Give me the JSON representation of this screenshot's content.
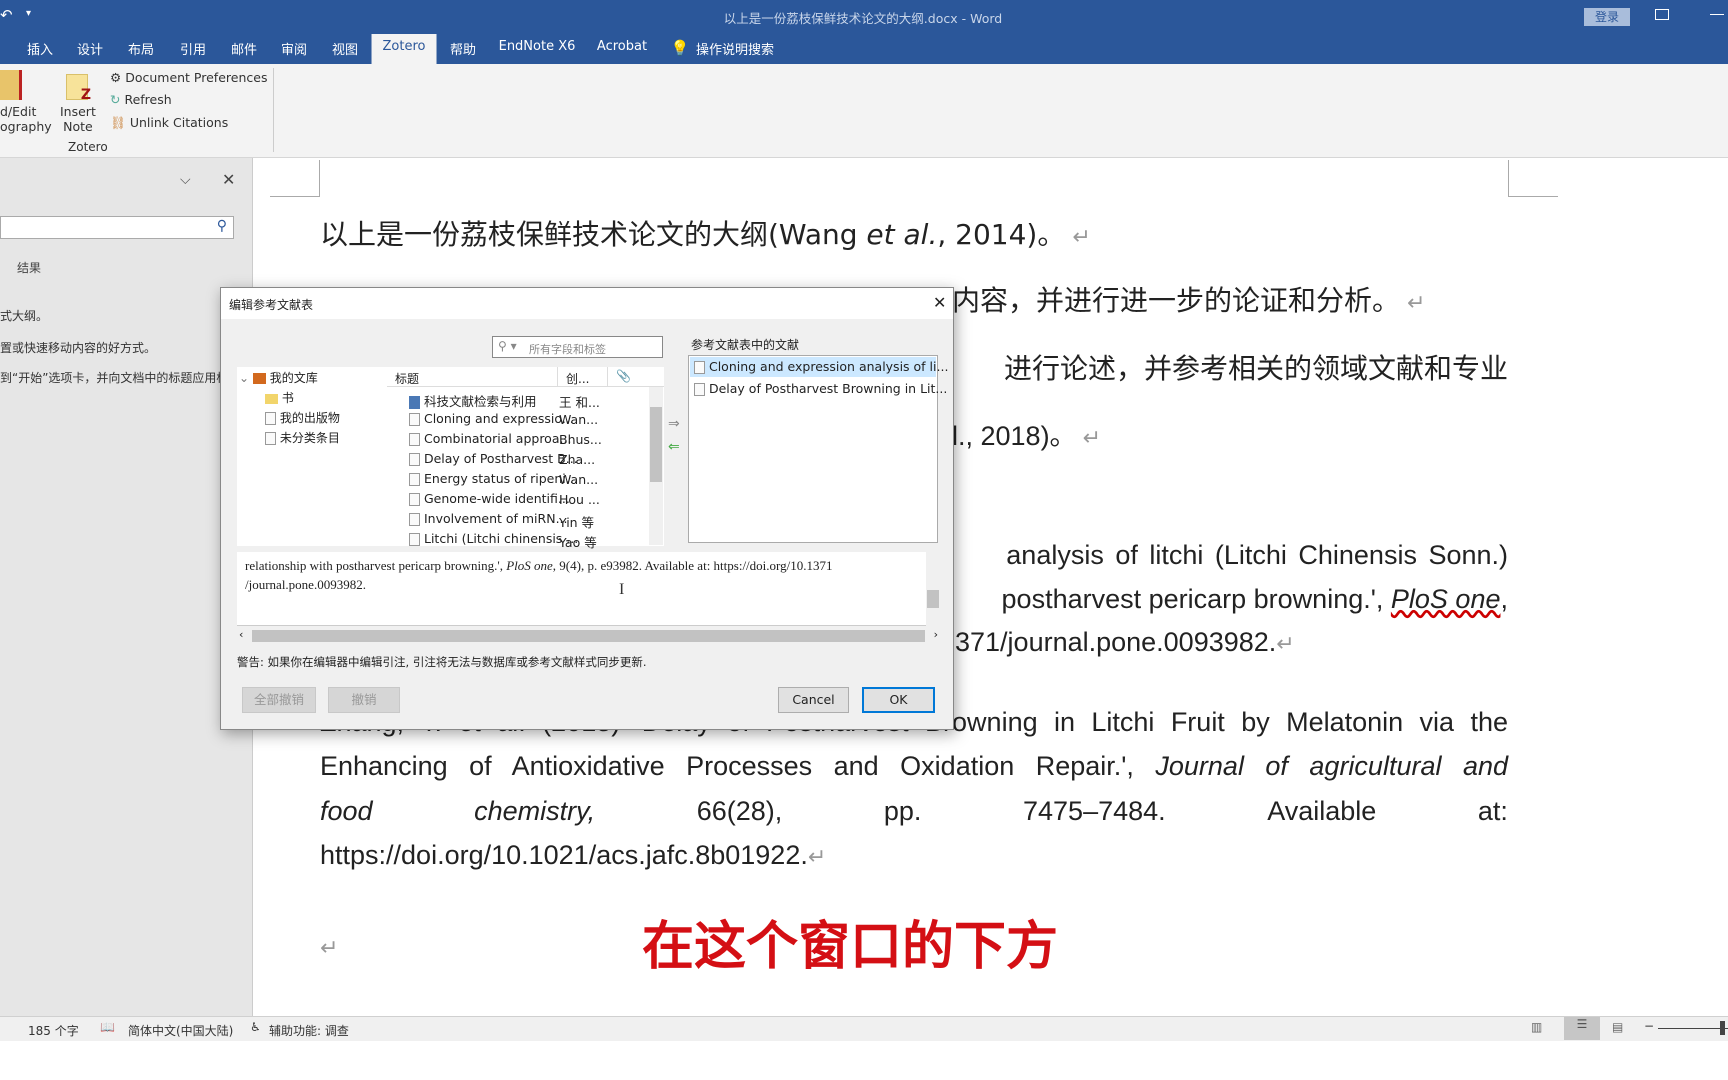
{
  "window": {
    "title": "以上是一份荔枝保鲜技术论文的大纲.docx  -  Word",
    "login": "登录",
    "quick_access": "↶",
    "qa_more": "▾"
  },
  "tabs": [
    "插入",
    "设计",
    "布局",
    "引用",
    "邮件",
    "审阅",
    "视图",
    "Zotero",
    "帮助",
    "EndNote X6",
    "Acrobat"
  ],
  "active_tab": "Zotero",
  "tell_me": "操作说明搜索",
  "ribbon": {
    "add_edit_bib": [
      "d/Edit",
      "ography"
    ],
    "insert_note": [
      "Insert",
      "Note"
    ],
    "doc_prefs": "Document Preferences",
    "refresh": "Refresh",
    "unlink": "Unlink Citations",
    "group": "Zotero"
  },
  "nav": {
    "results": "结果",
    "lines": [
      "式大纲。",
      "置或快速移动内容的好方式。",
      "到“开始”选项卡，并向文档中的标题应用标"
    ]
  },
  "document": {
    "line1_pre": "以上是一份荔枝保鲜技术论文的大纲(Wang ",
    "line1_it": "et al.",
    "line1_post": ", 2014)。",
    "line2": "内容，并进行进一步的论证和分析。",
    "line3": "进行论述，并参考相关的领域文献和专业",
    "line4": "l., 2018)。",
    "ref1_l1": "analysis of litchi (Litchi Chinensis Sonn.)",
    "ref1_l2_pre": "postharvest pericarp browning.', ",
    "ref1_l2_it": "PloS one",
    "ref1_l3": "371/journal.pone.0093982.",
    "ref2_l1": "Zhang, Y. et al. (2018) 'Delay of Postharvest Browning in Litchi Fruit by Melatonin via the",
    "ref2_l2_pre": "Enhancing of Antioxidative Processes and Oxidation Repair.', ",
    "ref2_l2_it": "Journal of agricultural and",
    "ref2_l3": [
      "food",
      "chemistry,",
      "66(28),",
      "pp.",
      "7475–7484.",
      "Available",
      "at:"
    ],
    "ref2_l4": "https://doi.org/10.1021/acs.jafc.8b01922.",
    "annotation": "在这个窗口的下方",
    "annotation_color": "#d40f14"
  },
  "dialog": {
    "title": "编辑参考文献表",
    "search_placeholder": "所有字段和标签",
    "right_label": "参考文献表中的文献",
    "tree": [
      "我的文库",
      "书",
      "我的出版物",
      "未分类条目"
    ],
    "col_title": "标题",
    "col_creator": "创...",
    "items": [
      [
        "科技文献检索与利用",
        "王 和..."
      ],
      [
        "Cloning and expressio...",
        "Wan..."
      ],
      [
        "Combinatorial approa...",
        "Bhus..."
      ],
      [
        "Delay of Postharvest B...",
        "Zha..."
      ],
      [
        "Energy status of ripeni...",
        "Wan..."
      ],
      [
        "Genome-wide identifi...",
        "Hou ..."
      ],
      [
        "Involvement of miRN...",
        "Yin 等"
      ],
      [
        "Litchi (Litchi chinensis ...",
        "Yao 等"
      ]
    ],
    "bib_items": [
      "Cloning and expression analysis of li...",
      "Delay of Postharvest Browning in Lit..."
    ],
    "editor_l1_pre": "relationship with postharvest pericarp browning.', ",
    "editor_l1_it": "PloS one",
    "editor_l1_post": ", 9(4), p. e93982. Available at: https://doi.org/10.1371",
    "editor_l2": "/journal.pone.0093982.",
    "warning": "警告: 如果你在编辑器中编辑引注, 引注将无法与数据库或参考文献样式同步更新.",
    "revert_all": "全部撤销",
    "revert": "撤销",
    "cancel": "Cancel",
    "ok": "OK"
  },
  "status": {
    "words": "185 个字",
    "language": "简体中文(中国大陆)",
    "accessibility": "辅助功能: 调查"
  },
  "colors": {
    "word_blue": "#2b579a",
    "selection": "#cce8ff"
  }
}
